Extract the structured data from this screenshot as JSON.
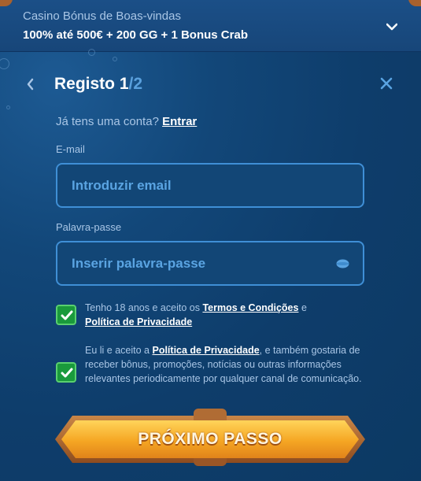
{
  "banner": {
    "subtitle": "Casino Bónus de Boas-vindas",
    "title": "100% até 500€ + 200 GG + 1 Bonus Crab"
  },
  "header": {
    "title": "Registo 1",
    "total": "/2"
  },
  "login": {
    "prompt": "Já tens uma conta?",
    "link": "Entrar"
  },
  "email": {
    "label": "E-mail",
    "placeholder": "Introduzir email"
  },
  "password": {
    "label": "Palavra-passe",
    "placeholder": "Inserir palavra-passe"
  },
  "terms": {
    "checked": true,
    "text_before": "Tenho 18 anos e aceito os",
    "link_terms": "Termos e Condições",
    "and": "e",
    "link_privacy": "Política de Privacidade"
  },
  "marketing": {
    "checked": true,
    "text_before": "Eu li e aceito a",
    "link_privacy": "Política de Privacidade",
    "text_after": ", e também gostaria de receber bônus, promoções, notícias ou outras informações relevantes periodicamente por qualquer canal de comunicação."
  },
  "cta": {
    "label": "PRÓXIMO PASSO"
  },
  "colors": {
    "background": "#0d3a66",
    "accent": "#3f8fd6",
    "checkbox": "#1a9a3c",
    "button": "#f5a623"
  },
  "icons": [
    "chevron-down-icon",
    "back-arrow-icon",
    "close-icon",
    "eye-icon",
    "checkmark-icon"
  ]
}
